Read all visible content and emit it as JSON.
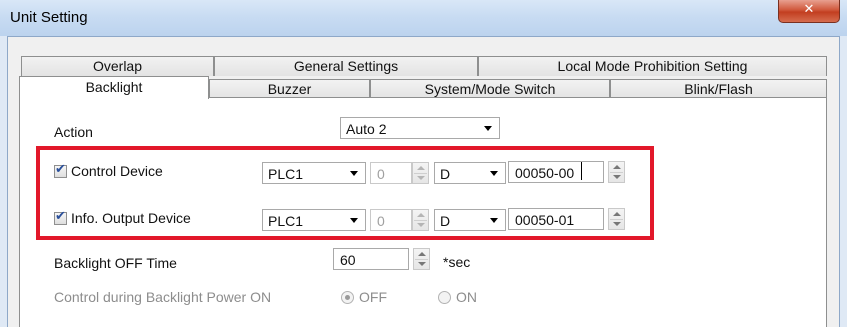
{
  "window": {
    "title": "Unit Setting",
    "close_glyph": "✕"
  },
  "tabs": {
    "row1": [
      "Overlap",
      "General Settings",
      "Local Mode Prohibition Setting"
    ],
    "row2": [
      "Backlight",
      "Buzzer",
      "System/Mode Switch",
      "Blink/Flash"
    ],
    "active": "Backlight"
  },
  "action": {
    "label": "Action",
    "value": "Auto 2"
  },
  "control_device": {
    "label": "Control Device",
    "checked": true,
    "plc": "PLC1",
    "station": "0",
    "device_type": "D",
    "address": "00050-00"
  },
  "info_output_device": {
    "label": "Info. Output Device",
    "checked": true,
    "plc": "PLC1",
    "station": "0",
    "device_type": "D",
    "address": "00050-01"
  },
  "backlight_off_time": {
    "label": "Backlight OFF Time",
    "value": "60",
    "unit": "*sec"
  },
  "control_power_on": {
    "label": "Control during Backlight Power ON",
    "off_label": "OFF",
    "on_label": "ON",
    "selected": "OFF"
  },
  "colors": {
    "highlight": "#e2182a",
    "titlebar": "#c7dbf2",
    "close_button": "#c23e20",
    "checkbox_mark": "#2a4f9a"
  },
  "icons": {
    "checkbox_check": "✔"
  }
}
